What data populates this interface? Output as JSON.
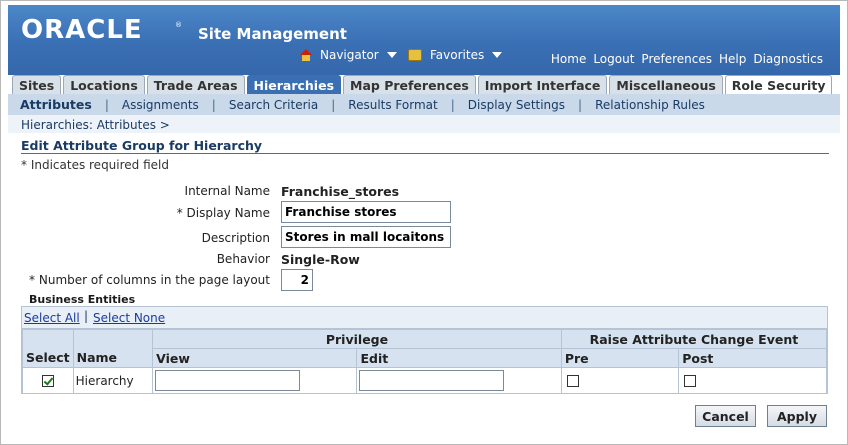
{
  "header": {
    "logo": "ORACLE",
    "app_title": "Site Management",
    "navigator_label": "Navigator",
    "favorites_label": "Favorites",
    "global_links": [
      "Home",
      "Logout",
      "Preferences",
      "Help",
      "Diagnostics"
    ]
  },
  "tabs": [
    "Sites",
    "Locations",
    "Trade Areas",
    "Hierarchies",
    "Map Preferences",
    "Import Interface",
    "Miscellaneous",
    "Role Security"
  ],
  "active_tab": "Hierarchies",
  "subtabs": [
    "Attributes",
    "Assignments",
    "Search Criteria",
    "Results Format",
    "Display Settings",
    "Relationship Rules"
  ],
  "active_subtab": "Attributes",
  "breadcrumb": "Hierarchies: Attributes >",
  "page_title": "Edit Attribute Group for Hierarchy",
  "required_note": "* Indicates required field",
  "form": {
    "internal_name_label": "Internal Name",
    "internal_name_value": "Franchise_stores",
    "display_name_label": "* Display Name",
    "display_name_value": "Franchise stores",
    "description_label": "Description",
    "description_value": "Stores in mall locaitons",
    "behavior_label": "Behavior",
    "behavior_value": "Single-Row",
    "columns_label": "* Number of columns in the page layout",
    "columns_value": "2"
  },
  "business_entities": {
    "heading": "Business Entities",
    "select_all": "Select All",
    "select_none": "Select None",
    "headers": {
      "privilege": "Privilege",
      "raise_event": "Raise Attribute Change Event",
      "select": "Select",
      "name": "Name",
      "view": "View",
      "edit": "Edit",
      "pre": "Pre",
      "post": "Post"
    },
    "rows": [
      {
        "selected": true,
        "name": "Hierarchy",
        "view": "",
        "edit": "",
        "pre": false,
        "post": false
      }
    ]
  },
  "buttons": {
    "cancel": "Cancel",
    "apply": "Apply"
  }
}
